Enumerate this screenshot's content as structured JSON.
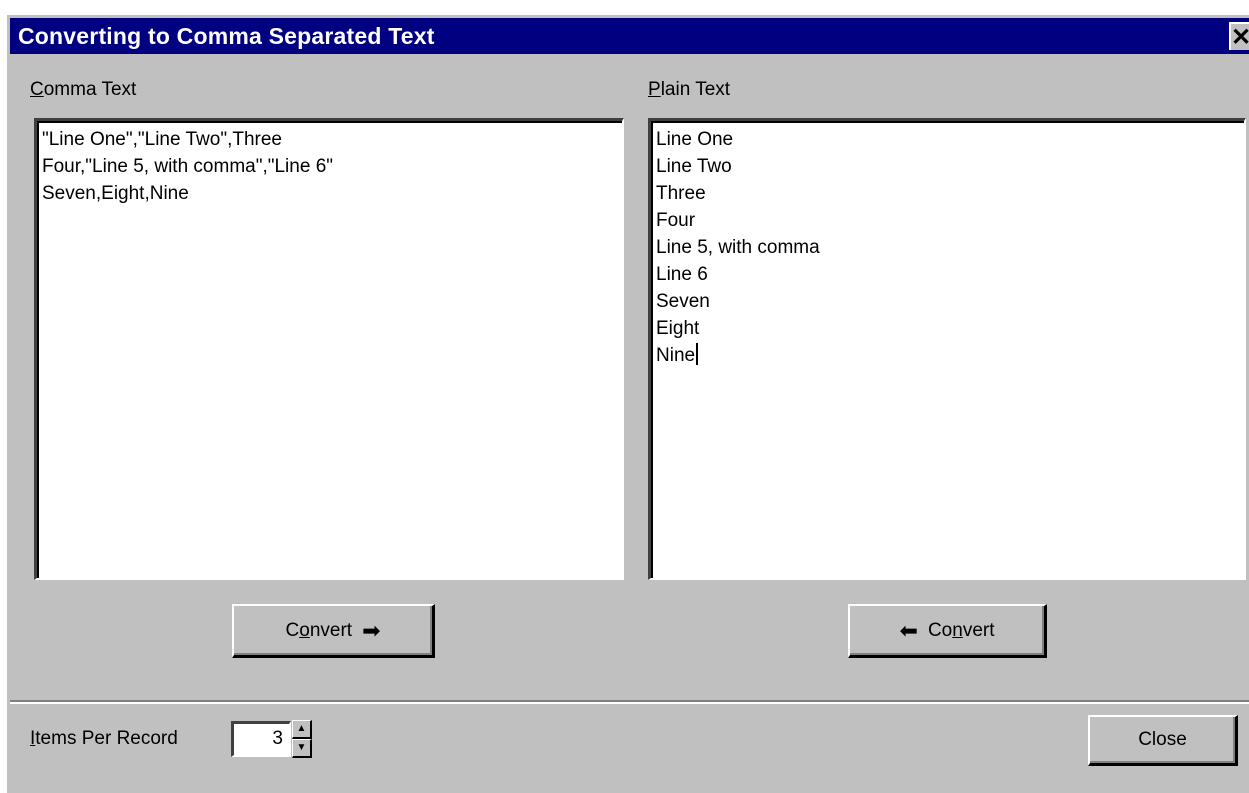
{
  "window": {
    "title": "Converting to Comma Separated Text",
    "close_glyph": "✕"
  },
  "left_panel": {
    "label_underline": "C",
    "label_rest": "omma Text",
    "lines": [
      "\"Line One\",\"Line Two\",Three",
      "Four,\"Line 5, with comma\",\"Line 6\"",
      "Seven,Eight,Nine"
    ]
  },
  "right_panel": {
    "label_underline": "P",
    "label_rest": "lain Text",
    "lines": [
      "Line One",
      "Line Two",
      "Three",
      "Four",
      "Line 5, with comma",
      "Line 6",
      "Seven",
      "Eight",
      "Nine"
    ]
  },
  "buttons": {
    "convert_right": {
      "pre": "C",
      "underline": "o",
      "post": "nvert",
      "arrow": "➡"
    },
    "convert_left": {
      "pre": "Co",
      "underline": "n",
      "post": "vert",
      "arrow": "⬅"
    },
    "close": "Close"
  },
  "items_per_record": {
    "label_underline": "I",
    "label_rest": "tems Per Record",
    "value": "3",
    "up_icon": "▲",
    "down_icon": "▼"
  },
  "icons": [
    "close-icon",
    "right-arrow-icon",
    "left-arrow-icon",
    "spin-up-icon",
    "spin-down-icon"
  ]
}
